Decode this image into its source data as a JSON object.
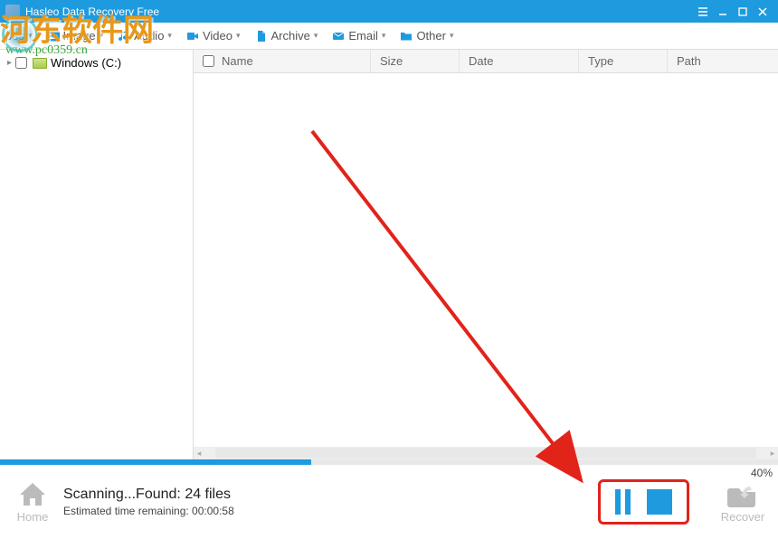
{
  "titlebar": {
    "title": "Hasleo Data Recovery Free"
  },
  "toolbar": {
    "types": "pes",
    "image": "Image",
    "audio": "Audio",
    "video": "Video",
    "archive": "Archive",
    "email": "Email",
    "other": "Other"
  },
  "sidebar": {
    "drive": "Windows (C:)"
  },
  "table": {
    "headers": {
      "name": "Name",
      "size": "Size",
      "date": "Date",
      "type": "Type",
      "path": "Path"
    }
  },
  "footer": {
    "home": "Home",
    "status_line1": "Scanning...Found: 24 files",
    "status_line2": "Estimated time remaining:   00:00:58",
    "recover": "Recover",
    "percent": "40%"
  },
  "progress": {
    "percent": 40
  },
  "watermark": {
    "big": "河东软件网",
    "url": "www.pc0359.cn"
  }
}
